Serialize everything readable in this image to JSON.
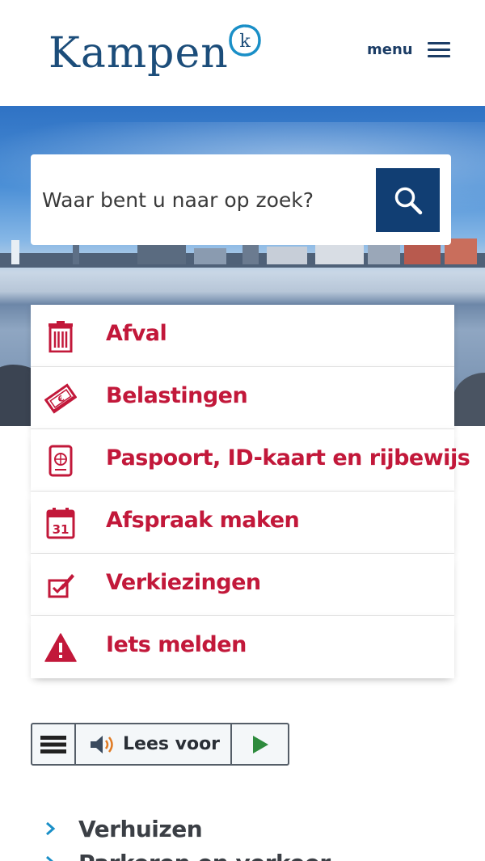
{
  "header": {
    "logo_text": "Kampen",
    "logo_mark_letter": "k",
    "menu_label": "menu"
  },
  "search": {
    "placeholder": "Waar bent u naar op zoek?",
    "button_icon": "search-icon"
  },
  "tasks": [
    {
      "label": "Afval",
      "icon": "trash-icon"
    },
    {
      "label": "Belastingen",
      "icon": "money-icon"
    },
    {
      "label": "Paspoort, ID-kaart en rijbewijs",
      "icon": "passport-icon"
    },
    {
      "label": "Afspraak maken",
      "icon": "calendar-icon",
      "icon_text": "31"
    },
    {
      "label": "Verkiezingen",
      "icon": "ballot-icon"
    },
    {
      "label": "Iets melden",
      "icon": "warning-icon"
    }
  ],
  "readspeaker": {
    "label": "Lees voor",
    "menu_icon": "menu-icon",
    "speaker_icon": "speaker-icon",
    "play_icon": "play-icon"
  },
  "links": [
    {
      "label": "Verhuizen"
    },
    {
      "label": "Parkeren en verkeer"
    }
  ],
  "colors": {
    "brand_blue": "#1c4d7a",
    "search_button": "#113e73",
    "task_red": "#c2183a",
    "link_chevron": "#1a8fc7",
    "play_green": "#2e8b3d"
  }
}
